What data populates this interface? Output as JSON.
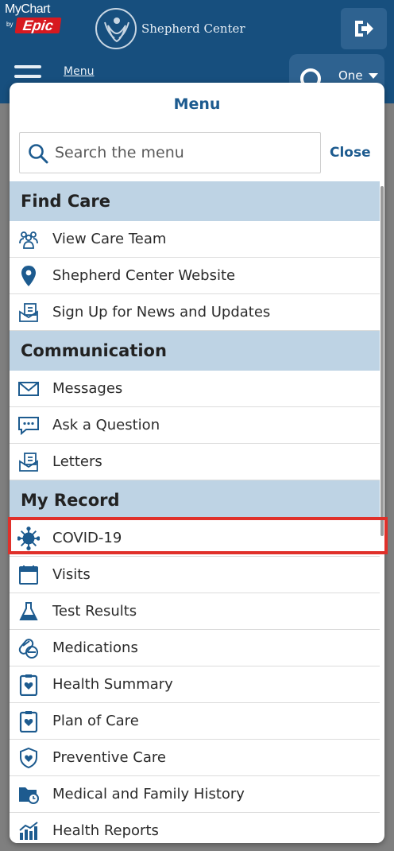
{
  "header": {
    "mychart_text": "MyChart",
    "by_text": "by",
    "epic_text": "Epic",
    "org_name": "Shepherd Center",
    "menu_link": "Menu",
    "account_label": "One"
  },
  "panel": {
    "title": "Menu",
    "search_placeholder": "Search the menu",
    "close_label": "Close"
  },
  "sections": [
    {
      "title": "Find Care",
      "items": [
        {
          "label": "View Care Team",
          "icon": "care-team-icon"
        },
        {
          "label": "Shepherd Center Website",
          "icon": "location-pin-icon"
        },
        {
          "label": "Sign Up for News and Updates",
          "icon": "letter-icon"
        }
      ]
    },
    {
      "title": "Communication",
      "items": [
        {
          "label": "Messages",
          "icon": "envelope-icon"
        },
        {
          "label": "Ask a Question",
          "icon": "chat-bubble-icon"
        },
        {
          "label": "Letters",
          "icon": "letter-icon"
        }
      ]
    },
    {
      "title": "My Record",
      "items": [
        {
          "label": "COVID-19",
          "icon": "virus-icon"
        },
        {
          "label": "Visits",
          "icon": "calendar-icon"
        },
        {
          "label": "Test Results",
          "icon": "flask-icon"
        },
        {
          "label": "Medications",
          "icon": "pills-icon"
        },
        {
          "label": "Health Summary",
          "icon": "clipboard-heart-icon"
        },
        {
          "label": "Plan of Care",
          "icon": "clipboard-heart-icon"
        },
        {
          "label": "Preventive Care",
          "icon": "shield-heart-icon"
        },
        {
          "label": "Medical and Family History",
          "icon": "folder-clock-icon"
        },
        {
          "label": "Health Reports",
          "icon": "bar-chart-icon"
        }
      ]
    }
  ],
  "colors": {
    "header_bg": "#174f7e",
    "accent_blue": "#1d5b8f",
    "section_bg": "#bed3e4",
    "highlight_red": "#e0302a"
  }
}
